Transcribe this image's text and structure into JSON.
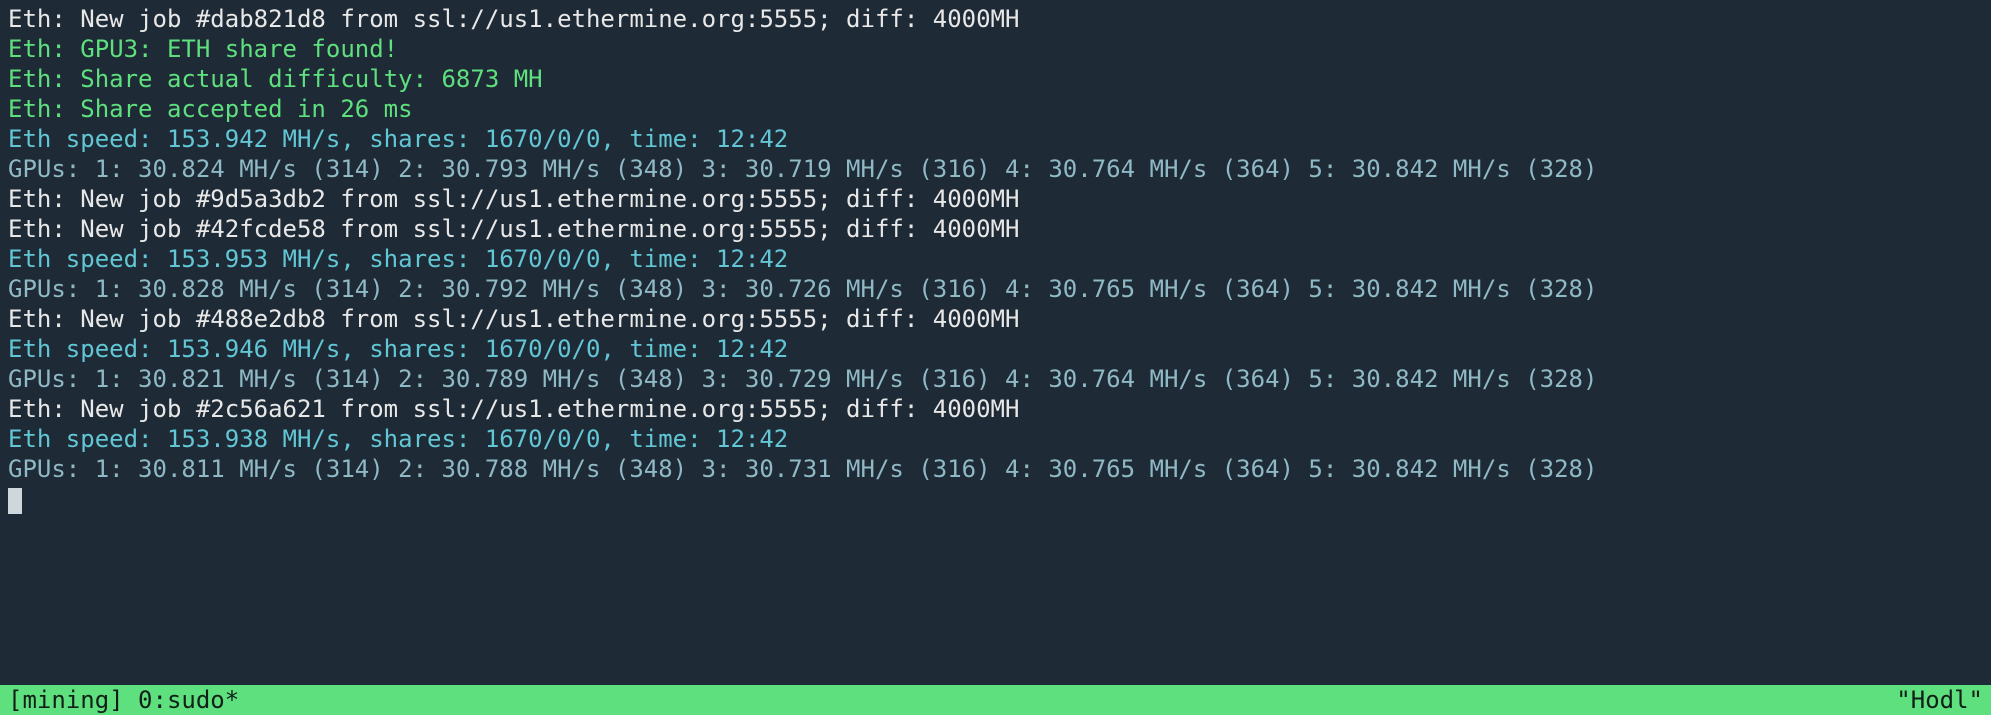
{
  "lines": [
    {
      "cls": "white",
      "text": "Eth: New job #dab821d8 from ssl://us1.ethermine.org:5555; diff: 4000MH"
    },
    {
      "cls": "green",
      "text": "Eth: GPU3: ETH share found!"
    },
    {
      "cls": "green",
      "text": "Eth: Share actual difficulty: 6873 MH"
    },
    {
      "cls": "green",
      "text": "Eth: Share accepted in 26 ms"
    },
    {
      "cls": "cyan",
      "text": "Eth speed: 153.942 MH/s, shares: 1670/0/0, time: 12:42"
    },
    {
      "cls": "palecyan",
      "text": "GPUs: 1: 30.824 MH/s (314) 2: 30.793 MH/s (348) 3: 30.719 MH/s (316) 4: 30.764 MH/s (364) 5: 30.842 MH/s (328)"
    },
    {
      "cls": "white",
      "text": "Eth: New job #9d5a3db2 from ssl://us1.ethermine.org:5555; diff: 4000MH"
    },
    {
      "cls": "white",
      "text": "Eth: New job #42fcde58 from ssl://us1.ethermine.org:5555; diff: 4000MH"
    },
    {
      "cls": "cyan",
      "text": "Eth speed: 153.953 MH/s, shares: 1670/0/0, time: 12:42"
    },
    {
      "cls": "palecyan",
      "text": "GPUs: 1: 30.828 MH/s (314) 2: 30.792 MH/s (348) 3: 30.726 MH/s (316) 4: 30.765 MH/s (364) 5: 30.842 MH/s (328)"
    },
    {
      "cls": "white",
      "text": "Eth: New job #488e2db8 from ssl://us1.ethermine.org:5555; diff: 4000MH"
    },
    {
      "cls": "cyan",
      "text": "Eth speed: 153.946 MH/s, shares: 1670/0/0, time: 12:42"
    },
    {
      "cls": "palecyan",
      "text": "GPUs: 1: 30.821 MH/s (314) 2: 30.789 MH/s (348) 3: 30.729 MH/s (316) 4: 30.764 MH/s (364) 5: 30.842 MH/s (328)"
    },
    {
      "cls": "white",
      "text": "Eth: New job #2c56a621 from ssl://us1.ethermine.org:5555; diff: 4000MH"
    },
    {
      "cls": "cyan",
      "text": "Eth speed: 153.938 MH/s, shares: 1670/0/0, time: 12:42"
    },
    {
      "cls": "palecyan",
      "text": "GPUs: 1: 30.811 MH/s (314) 2: 30.788 MH/s (348) 3: 30.731 MH/s (316) 4: 30.765 MH/s (364) 5: 30.842 MH/s (328)"
    }
  ],
  "status": {
    "left": "[mining] 0:sudo*",
    "right": "\"Hodl\""
  }
}
